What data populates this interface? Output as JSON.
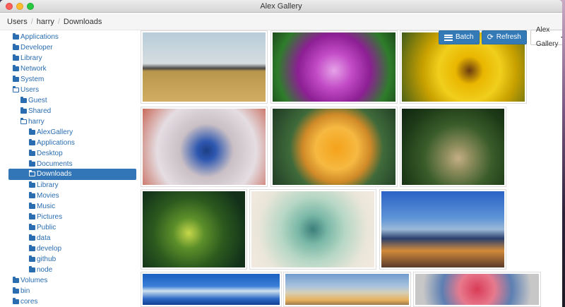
{
  "window": {
    "title": "Alex Gallery"
  },
  "breadcrumb": [
    "Users",
    "harry",
    "Downloads"
  ],
  "sidebar": {
    "items": [
      {
        "label": "Applications",
        "open": false,
        "active": false,
        "level": 0
      },
      {
        "label": "Developer",
        "open": false,
        "active": false,
        "level": 0
      },
      {
        "label": "Library",
        "open": false,
        "active": false,
        "level": 0
      },
      {
        "label": "Network",
        "open": false,
        "active": false,
        "level": 0
      },
      {
        "label": "System",
        "open": false,
        "active": false,
        "level": 0
      },
      {
        "label": "Users",
        "open": true,
        "active": false,
        "level": 0
      },
      {
        "label": "Guest",
        "open": false,
        "active": false,
        "level": 1
      },
      {
        "label": "Shared",
        "open": false,
        "active": false,
        "level": 1
      },
      {
        "label": "harry",
        "open": true,
        "active": false,
        "level": 1
      },
      {
        "label": "AlexGallery",
        "open": false,
        "active": false,
        "level": 2
      },
      {
        "label": "Applications",
        "open": false,
        "active": false,
        "level": 2
      },
      {
        "label": "Desktop",
        "open": false,
        "active": false,
        "level": 2
      },
      {
        "label": "Documents",
        "open": false,
        "active": false,
        "level": 2
      },
      {
        "label": "Downloads",
        "open": true,
        "active": true,
        "level": 2
      },
      {
        "label": "Library",
        "open": false,
        "active": false,
        "level": 2
      },
      {
        "label": "Movies",
        "open": false,
        "active": false,
        "level": 2
      },
      {
        "label": "Music",
        "open": false,
        "active": false,
        "level": 2
      },
      {
        "label": "Pictures",
        "open": false,
        "active": false,
        "level": 2
      },
      {
        "label": "Public",
        "open": false,
        "active": false,
        "level": 2
      },
      {
        "label": "data",
        "open": false,
        "active": false,
        "level": 2
      },
      {
        "label": "develop",
        "open": false,
        "active": false,
        "level": 2
      },
      {
        "label": "github",
        "open": false,
        "active": false,
        "level": 2
      },
      {
        "label": "node",
        "open": false,
        "active": false,
        "level": 2
      },
      {
        "label": "Volumes",
        "open": false,
        "active": false,
        "level": 0
      },
      {
        "label": "bin",
        "open": false,
        "active": false,
        "level": 0
      },
      {
        "label": "cores",
        "open": false,
        "active": false,
        "level": 0
      }
    ]
  },
  "toolbar": {
    "batch_label": "Batch",
    "refresh_label": "Refresh",
    "gallery_label": "Alex Gallery"
  },
  "gallery": {
    "photos": [
      {
        "subject": "savanna-landscape",
        "background": "linear-gradient(180deg,#b8ccd9 0%,#d5dde0 45%,#4a4a46 52%,#b8964c 56%,#d1ad64 100%)"
      },
      {
        "subject": "magenta-flower",
        "background": "radial-gradient(circle at 50% 55%,#e6a3e8 0%,#c24ac6 25%,#8d1f94 50%,#2e7d2b 78%,#1f4b1c 100%)"
      },
      {
        "subject": "yellow-pansies",
        "background": "radial-gradient(circle at 55% 55%,#6a3b10 0%,#e9b600 18%,#f0cf1c 40%,#c9a100 60%,#3f5b1a 100%)"
      },
      {
        "subject": "blue-berries",
        "background": "radial-gradient(circle at 52% 55%,#1e3e84 0%,#2d57b0 12%,#c9bfc5 35%,#e4dde2 65%,#c96a5a 100%)"
      },
      {
        "subject": "orange-rose",
        "background": "radial-gradient(circle at 52% 52%,#f4a21a 0%,#f6b941 28%,#d08a28 45%,#3f6a3a 62%,#1f3a24 100%)"
      },
      {
        "subject": "jungle-snake",
        "background": "radial-gradient(circle at 55% 65%,#c5ae86 0%,#8b8b5c 18%,#3a5d2a 45%,#1d3a17 75%,#0f2411 100%)"
      },
      {
        "subject": "green-viper",
        "background": "radial-gradient(circle at 45% 55%,#c7d84a 0%,#5c8f2a 22%,#2c5a1e 50%,#12301a 85%)"
      },
      {
        "subject": "succulent",
        "background": "radial-gradient(circle at 50% 50%,#3a7f7a 0%,#79b7a6 20%,#b7d7c5 45%,#e9e6d9 75%,#f4e9e0 100%)"
      },
      {
        "subject": "city-skyline",
        "background": "linear-gradient(180deg,#2a62c6 0%,#5e94d6 35%,#9cb9d8 50%,#2a3f6b 62%,#d28a3a 78%,#5a3a2a 100%)"
      },
      {
        "subject": "cloudy-sky",
        "background": "linear-gradient(180deg,#1b5fc0 0%,#3b7fd8 40%,#cfe2ef 55%,#2f6bc5 80%,#0f3f94 100%)"
      },
      {
        "subject": "sunset-clouds",
        "background": "linear-gradient(180deg,#6f9ccc 0%,#a9c3de 40%,#d6d0b9 60%,#e7b05c 85%,#9a7a4e 100%)"
      },
      {
        "subject": "red-berries",
        "background": "radial-gradient(circle at 50% 50%,#d93b55 0%,#e77a8e 28%,#5d7fb2 55%,#c7c7c7 85%)"
      }
    ]
  }
}
